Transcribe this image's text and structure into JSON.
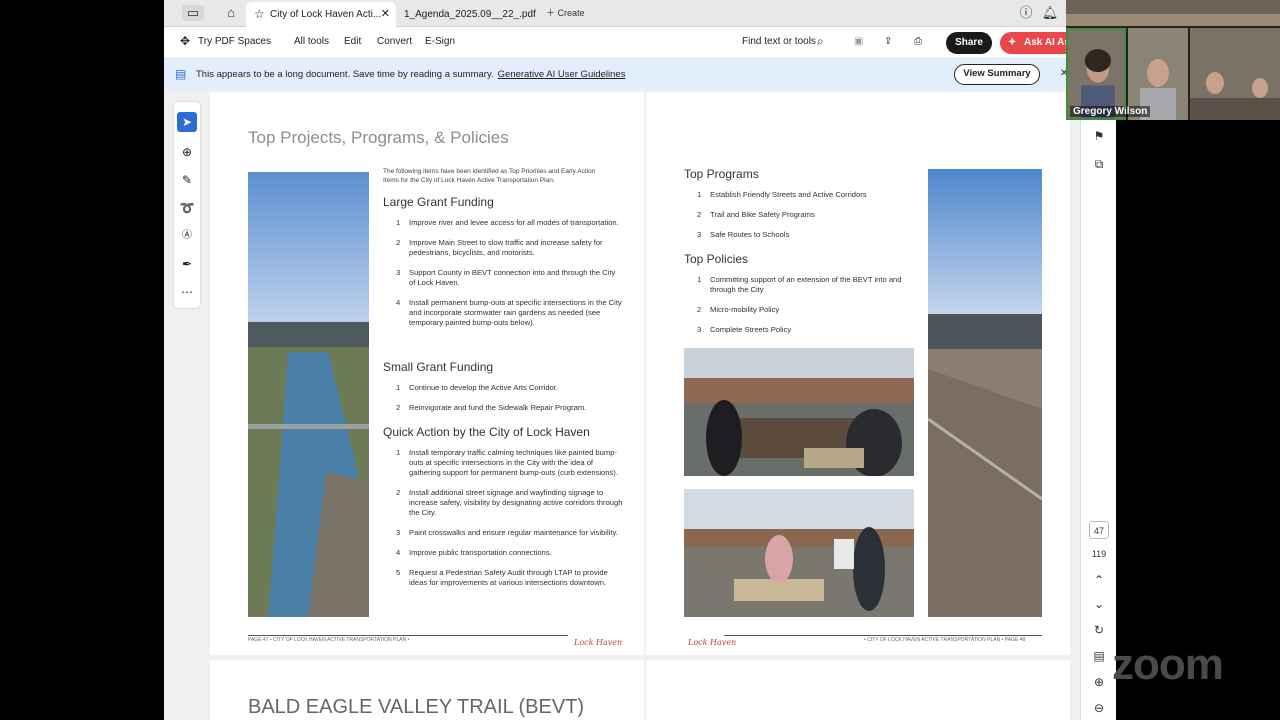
{
  "tabs": {
    "active_title": "City of Lock Haven Acti...",
    "second_title": "1_Agenda_2025.09__22_.pdf",
    "create_label": "Create"
  },
  "toolbar": {
    "try_spaces": "Try PDF Spaces",
    "all_tools": "All tools",
    "edit": "Edit",
    "convert": "Convert",
    "esign": "E-Sign",
    "find": "Find text or tools",
    "share": "Share",
    "ask_ai": "Ask AI Assistant"
  },
  "banner": {
    "message": "This appears to be a long document. Save time by reading a summary.",
    "link": "Generative AI User Guidelines",
    "button": "View Summary"
  },
  "page47": {
    "title": "Top Projects, Programs, & Policies",
    "intro": "The following items have been identified as Top Priorities and Early Action Items for the City of Lock Haven Active Transportation Plan:",
    "large_grant": {
      "heading": "Large Grant Funding",
      "items": [
        "Improve river and levee access for all modes of transportation.",
        "Improve Main Street to slow traffic and increase safety for pedestrians, bicyclists, and motorists.",
        "Support County in BEVT connection into and through the City of Lock Haven.",
        "Install permanent bump-outs at specific intersections in the City and incorporate stormwater rain gardens as needed (see temporary painted bump-outs below)."
      ]
    },
    "small_grant": {
      "heading": "Small Grant Funding",
      "items": [
        "Continue to develop the Active Arts Corridor.",
        "Reinvigorate and fund the Sidewalk Repair Program."
      ]
    },
    "quick_action": {
      "heading": "Quick Action by the City of Lock Haven",
      "items": [
        "Install temporary traffic calming techniques like painted bump-outs at specific intersections in the City with the idea of gathering support for permanent bump-outs (curb extensions).",
        "Install additional street signage and wayfinding signage to increase safety, visibility by designating active corridors through the City.",
        "Paint crosswalks and ensure regular maintenance for visibility.",
        "Improve public transportation connections.",
        "Request a Pedestrian Safety Audit through LTAP to provide ideas for improvements at various intersections downtown."
      ]
    },
    "footer": "PAGE 47 • CITY OF LOCK HAVEN ACTIVE TRANSPORTATION PLAN •"
  },
  "page48": {
    "programs": {
      "heading": "Top Programs",
      "items": [
        "Establish Friendly Streets and Active Corridors",
        "Trail and Bike Safety Programs",
        "Safe Routes to Schools"
      ]
    },
    "policies": {
      "heading": "Top Policies",
      "items": [
        "Committing support of an extension of the BEVT into and through the City",
        "Micro-mobility Policy",
        "Complete Streets Policy"
      ]
    },
    "footer": "• CITY OF LOCK HAVEN ACTIVE TRANSPORTATION PLAN • PAGE 48"
  },
  "logo_text": "Lock Haven",
  "next_page_title": "BALD EAGLE VALLEY TRAIL (BEVT)",
  "page_nav": {
    "current": "47",
    "total": "119"
  },
  "video": {
    "speaker": "Gregory Wilson"
  },
  "watermark": "zoom",
  "numbers": [
    "1",
    "2",
    "3",
    "4",
    "5"
  ]
}
